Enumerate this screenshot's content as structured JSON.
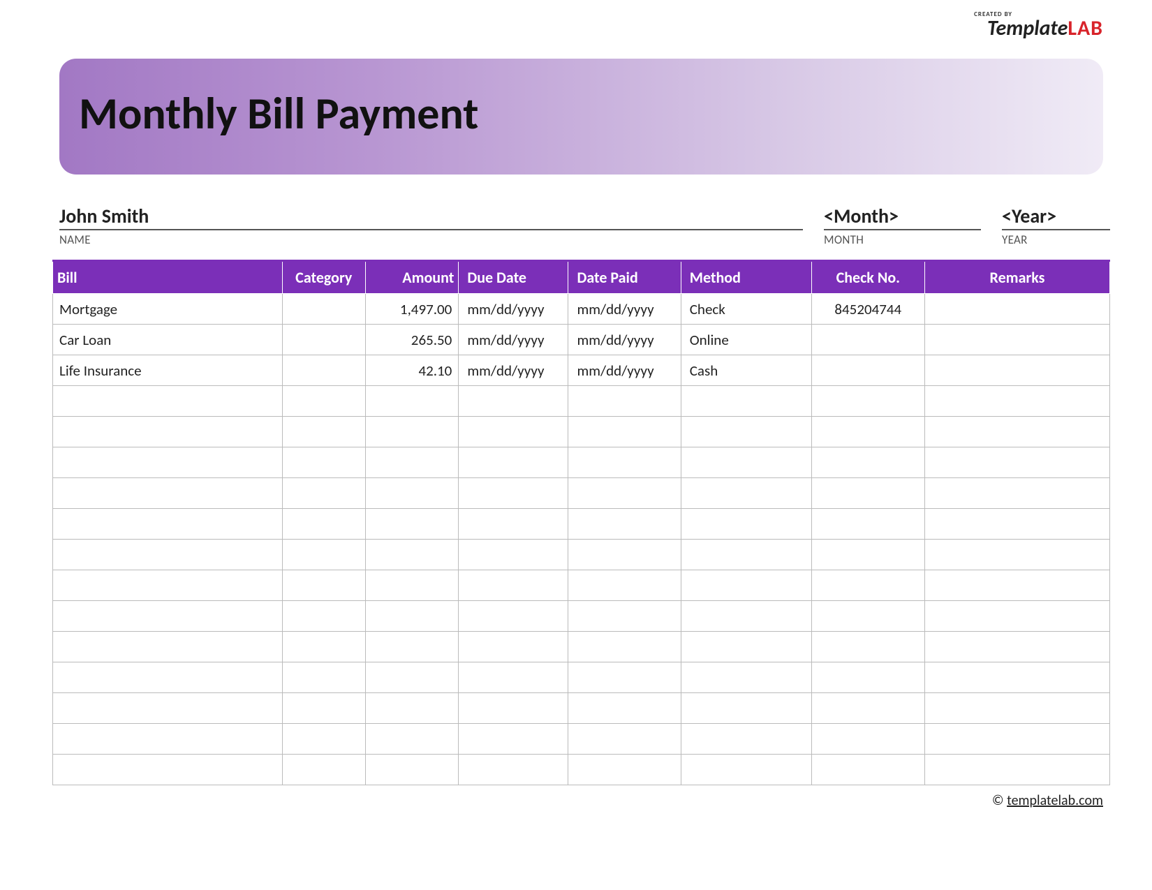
{
  "logo": {
    "created_by": "CREATED BY",
    "template": "Template",
    "lab": "LAB"
  },
  "header": {
    "title": "Monthly Bill Payment"
  },
  "fields": {
    "name_value": "John Smith",
    "name_label": "NAME",
    "month_value": "<Month>",
    "month_label": "MONTH",
    "year_value": "<Year>",
    "year_label": "YEAR"
  },
  "columns": {
    "bill": "Bill",
    "category": "Category",
    "amount": "Amount",
    "due_date": "Due Date",
    "date_paid": "Date Paid",
    "method": "Method",
    "check_no": "Check No.",
    "remarks": "Remarks"
  },
  "rows": [
    {
      "bill": "Mortgage",
      "category": "",
      "amount": "1,497.00",
      "due": "mm/dd/yyyy",
      "paid": "mm/dd/yyyy",
      "method": "Check",
      "check": "845204744",
      "remarks": ""
    },
    {
      "bill": "Car Loan",
      "category": "",
      "amount": "265.50",
      "due": "mm/dd/yyyy",
      "paid": "mm/dd/yyyy",
      "method": "Online",
      "check": "",
      "remarks": ""
    },
    {
      "bill": "Life Insurance",
      "category": "",
      "amount": "42.10",
      "due": "mm/dd/yyyy",
      "paid": "mm/dd/yyyy",
      "method": "Cash",
      "check": "",
      "remarks": ""
    },
    {
      "bill": "",
      "category": "",
      "amount": "",
      "due": "",
      "paid": "",
      "method": "",
      "check": "",
      "remarks": ""
    },
    {
      "bill": "",
      "category": "",
      "amount": "",
      "due": "",
      "paid": "",
      "method": "",
      "check": "",
      "remarks": ""
    },
    {
      "bill": "",
      "category": "",
      "amount": "",
      "due": "",
      "paid": "",
      "method": "",
      "check": "",
      "remarks": ""
    },
    {
      "bill": "",
      "category": "",
      "amount": "",
      "due": "",
      "paid": "",
      "method": "",
      "check": "",
      "remarks": ""
    },
    {
      "bill": "",
      "category": "",
      "amount": "",
      "due": "",
      "paid": "",
      "method": "",
      "check": "",
      "remarks": ""
    },
    {
      "bill": "",
      "category": "",
      "amount": "",
      "due": "",
      "paid": "",
      "method": "",
      "check": "",
      "remarks": ""
    },
    {
      "bill": "",
      "category": "",
      "amount": "",
      "due": "",
      "paid": "",
      "method": "",
      "check": "",
      "remarks": ""
    },
    {
      "bill": "",
      "category": "",
      "amount": "",
      "due": "",
      "paid": "",
      "method": "",
      "check": "",
      "remarks": ""
    },
    {
      "bill": "",
      "category": "",
      "amount": "",
      "due": "",
      "paid": "",
      "method": "",
      "check": "",
      "remarks": ""
    },
    {
      "bill": "",
      "category": "",
      "amount": "",
      "due": "",
      "paid": "",
      "method": "",
      "check": "",
      "remarks": ""
    },
    {
      "bill": "",
      "category": "",
      "amount": "",
      "due": "",
      "paid": "",
      "method": "",
      "check": "",
      "remarks": ""
    },
    {
      "bill": "",
      "category": "",
      "amount": "",
      "due": "",
      "paid": "",
      "method": "",
      "check": "",
      "remarks": ""
    },
    {
      "bill": "",
      "category": "",
      "amount": "",
      "due": "",
      "paid": "",
      "method": "",
      "check": "",
      "remarks": ""
    }
  ],
  "footer": {
    "copyright": "©",
    "link_text": "templatelab.com"
  }
}
